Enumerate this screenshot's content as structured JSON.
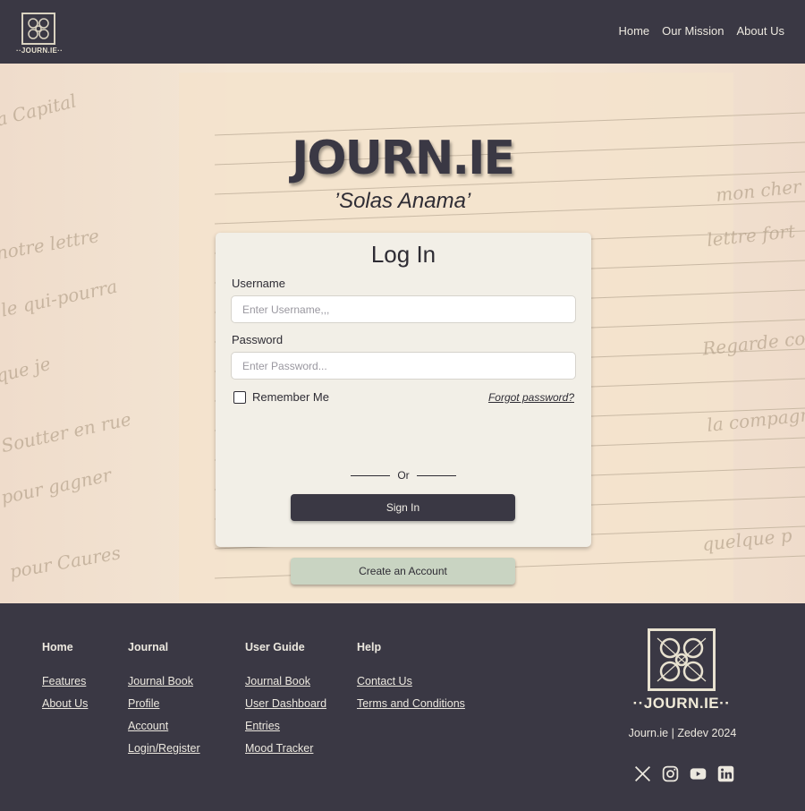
{
  "header": {
    "logo_text": "··JOURN.IE··",
    "nav": [
      "Home",
      "Our Mission",
      "About Us"
    ]
  },
  "hero": {
    "brand": "JOURN.IE",
    "tagline": "’Solas Anama’"
  },
  "login": {
    "title": "Log In",
    "username_label": "Username",
    "username_placeholder": "Enter Username,,,",
    "password_label": "Password",
    "password_placeholder": "Enter Password...",
    "remember_label": "Remember Me",
    "forgot_label": "Forgot password?",
    "signin_label": "Sign In",
    "or_label": "Or",
    "create_label": "Create an Account"
  },
  "footer": {
    "columns": [
      {
        "title": "Home",
        "items": [
          "Features",
          "About Us"
        ]
      },
      {
        "title": "Journal",
        "items": [
          "Journal Book",
          "Profile",
          "Account",
          "Login/Register"
        ]
      },
      {
        "title": "User Guide",
        "items": [
          "Journal Book",
          "User Dashboard",
          "Entries",
          "Mood Tracker"
        ]
      },
      {
        "title": "Help",
        "items": [
          "Contact Us",
          "Terms and Conditions"
        ]
      }
    ],
    "logo_text": "··JOURN.IE··",
    "copyright": "Journ.ie | Zedev 2024",
    "socials": [
      "x-icon",
      "instagram-icon",
      "youtube-icon",
      "linkedin-icon"
    ]
  },
  "colors": {
    "dark": "#3a3844",
    "card": "#f2efe7",
    "create_button": "#c9d4c2"
  }
}
